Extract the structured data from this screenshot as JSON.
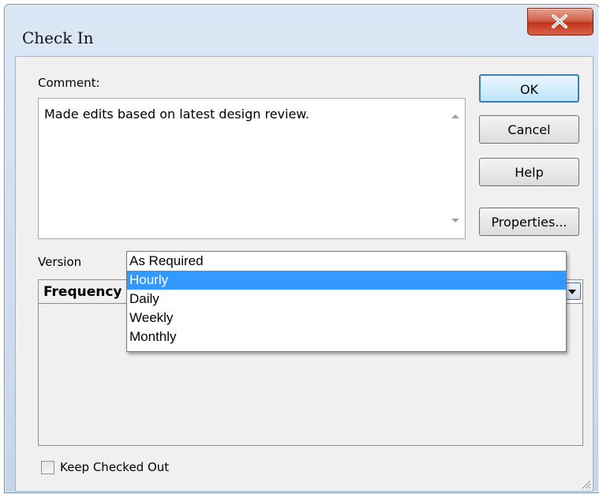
{
  "window": {
    "title": "Check In"
  },
  "comment": {
    "label": "Comment:",
    "value": "Made edits based on latest design review."
  },
  "buttons": {
    "ok": "OK",
    "cancel": "Cancel",
    "help": "Help",
    "properties": "Properties..."
  },
  "version": {
    "label": "Version",
    "field_label": "Frequency",
    "field_value": "",
    "options": [
      "As Required",
      "Hourly",
      "Daily",
      "Weekly",
      "Monthly"
    ],
    "highlighted_option": "Hourly"
  },
  "keep_checked_out": {
    "label": "Keep Checked Out",
    "checked": false
  },
  "colors": {
    "highlight": "#3399ff",
    "close_button": "#c2341c",
    "default_button_border": "#3c7fb1"
  },
  "icons": [
    "close-icon",
    "scroll-up-arrow-icon",
    "scroll-down-arrow-icon",
    "dropdown-arrow-icon",
    "resize-grip-icon"
  ]
}
